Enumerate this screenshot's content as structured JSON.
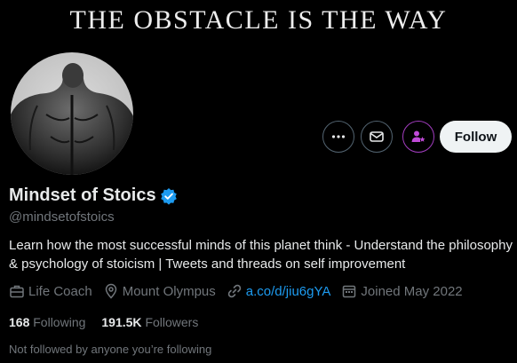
{
  "banner": {
    "title": "THE OBSTACLE IS THE WAY"
  },
  "actions": {
    "more_icon": "more-dots-icon",
    "message_icon": "mail-icon",
    "subscribe_icon": "subscribe-icon",
    "follow_label": "Follow"
  },
  "profile": {
    "display_name": "Mindset of Stoics",
    "verified_icon": "verified-badge-icon",
    "handle": "@mindsetofstoics",
    "bio": "Learn how the most successful minds of this planet think - Understand the philosophy & psychology of stoicism | Tweets and threads on self improvement"
  },
  "meta": {
    "category": "Life Coach",
    "location": "Mount Olympus",
    "link": "a.co/d/jiu6gYA",
    "joined": "Joined May 2022"
  },
  "stats": {
    "following_count": "168",
    "following_label": "Following",
    "followers_count": "191.5K",
    "followers_label": "Followers"
  },
  "social_context": "Not followed by anyone you’re following",
  "colors": {
    "background": "#000000",
    "text_primary": "#e7e9ea",
    "text_secondary": "#71767b",
    "link": "#1d9bf0",
    "verified": "#1d9bf0",
    "subscribe_accent": "#c04ad8"
  }
}
